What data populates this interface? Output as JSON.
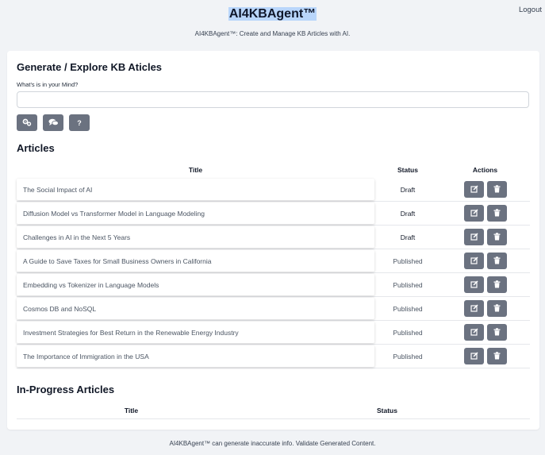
{
  "header": {
    "title": "AI4KBAgent™",
    "subtitle": "AI4KBAgent™: Create and Manage KB Articles with AI.",
    "logout_label": "Logout"
  },
  "generate": {
    "heading": "Generate / Explore KB Aticles",
    "prompt_label": "What's is in your Mind?",
    "prompt_value": "",
    "help_label": "?"
  },
  "articles": {
    "heading": "Articles",
    "columns": {
      "title": "Title",
      "status": "Status",
      "actions": "Actions"
    },
    "rows": [
      {
        "title": "The Social Impact of AI",
        "status": "Draft"
      },
      {
        "title": "Diffusion Model vs Transformer Model in Language Modeling",
        "status": "Draft"
      },
      {
        "title": "Challenges in AI in the Next 5 Years",
        "status": "Draft"
      },
      {
        "title": "A Guide to Save Taxes for Small Business Owners in California",
        "status": "Published"
      },
      {
        "title": "Embedding vs Tokenizer in Language Models",
        "status": "Published"
      },
      {
        "title": "Cosmos DB and NoSQL",
        "status": "Published"
      },
      {
        "title": "Investment Strategies for Best Return in the Renewable Energy Industry",
        "status": "Published"
      },
      {
        "title": "The Importance of Immigration in the USA",
        "status": "Published"
      }
    ]
  },
  "inprogress": {
    "heading": "In-Progress Articles",
    "columns": {
      "title": "Title",
      "status": "Status"
    }
  },
  "footer": {
    "disclaimer": "AI4KBAgent™ can generate inaccurate info. Validate Generated Content."
  },
  "colors": {
    "background": "#f1f3f6",
    "button": "#6b7280",
    "title_highlight": "#b9d6fb"
  },
  "icons": {
    "tool_1": "cogs-icon",
    "tool_2": "comments-icon",
    "edit": "edit-icon",
    "delete": "trash-icon"
  }
}
